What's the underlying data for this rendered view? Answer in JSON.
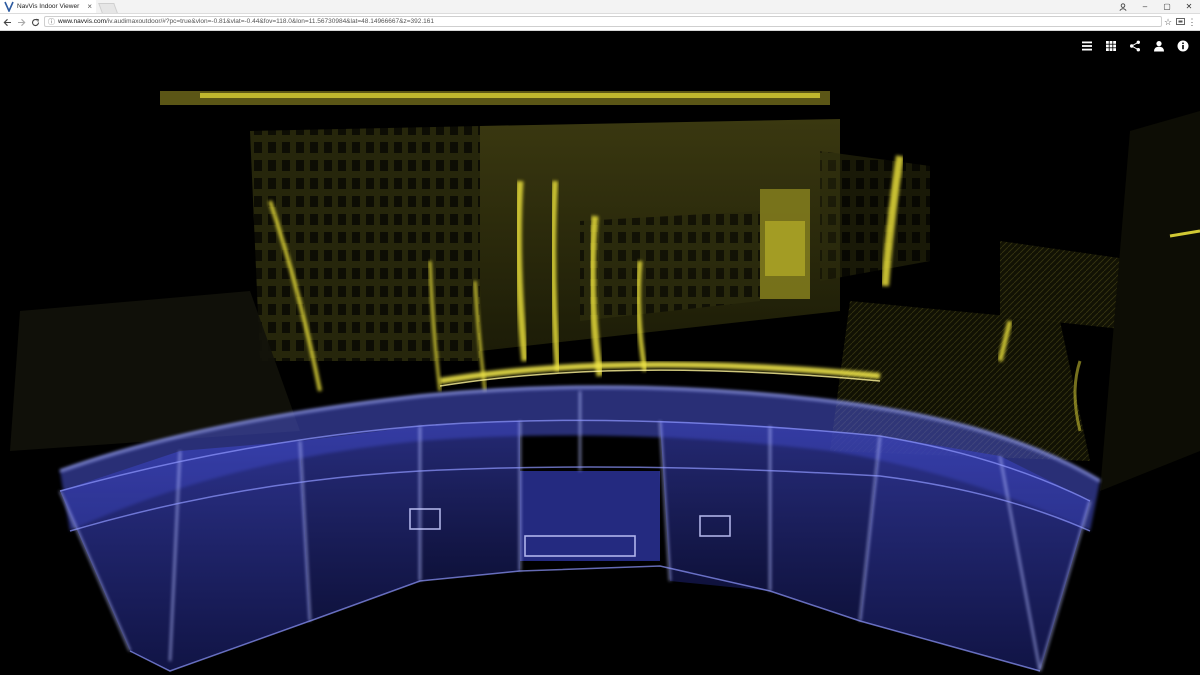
{
  "browser": {
    "tab_title": "NavVis Indoor Viewer",
    "tab_close": "×",
    "url_host": "www.navvis.com",
    "url_path": "/iv.audimaxoutdoor/#?pc=true&vlon=-0.81&vlat=-0.44&fov=118.0&lon=11.56730984&lat=48.14966667&z=392.161",
    "window_controls": {
      "minimize": "–",
      "maximize": "▢",
      "close": "✕"
    }
  },
  "viewer": {
    "toolbar_icons": [
      "layers-icon",
      "grid-icon",
      "share-icon",
      "user-icon",
      "info-icon"
    ]
  },
  "colors": {
    "point_cloud_yellow": "#e8de3a",
    "point_cloud_blue": "#6f7dff",
    "background": "#000000"
  }
}
